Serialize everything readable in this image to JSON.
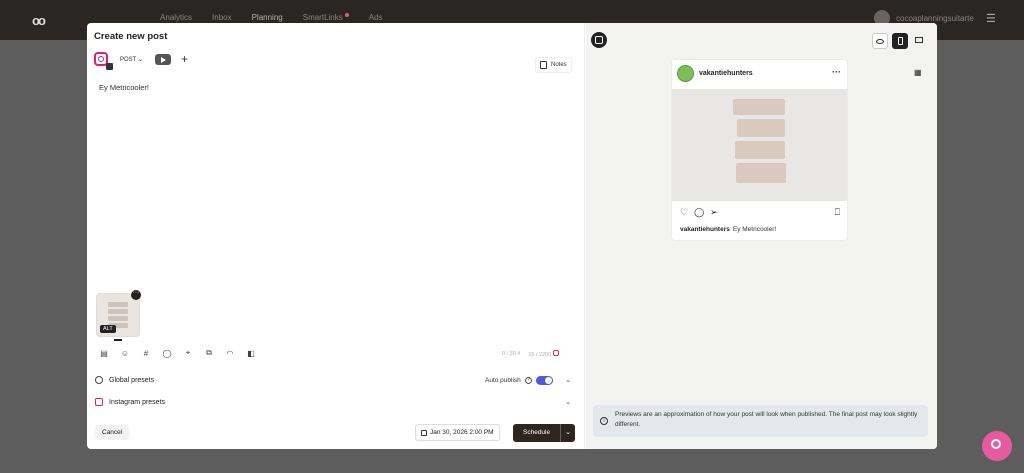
{
  "app": {
    "nav": [
      "Analytics",
      "Inbox",
      "Planning",
      "SmartLinks",
      "Ads"
    ],
    "account": "cocoaplanningsuitarte"
  },
  "modal": {
    "title": "Create new post",
    "post_type": "POST",
    "notes_label": "Notes",
    "editor_text": "Ey Metricooler!",
    "alt_label": "ALT",
    "counters": {
      "hashtags": "0 / 30",
      "chars": "15 / 2200"
    },
    "global_presets_label": "Global presets",
    "auto_publish_label": "Auto publish",
    "instagram_presets_label": "Instagram presets",
    "cancel_label": "Cancel",
    "date_label": "Jan 30, 2026 2:00 PM",
    "schedule_label": "Schedule"
  },
  "preview": {
    "username": "vakantiehunters",
    "caption_user": "vakantiehunters",
    "caption_text": "Ey Metricooler!",
    "info_text": "Previews are an approximation of how your post will look when published. The final post may look slightly different."
  },
  "colors": {
    "instagram": "#d6246e",
    "schedule_button": "#2e2420",
    "toggle_on": "#4a5bd8",
    "help_fab": "#e55aa0"
  }
}
